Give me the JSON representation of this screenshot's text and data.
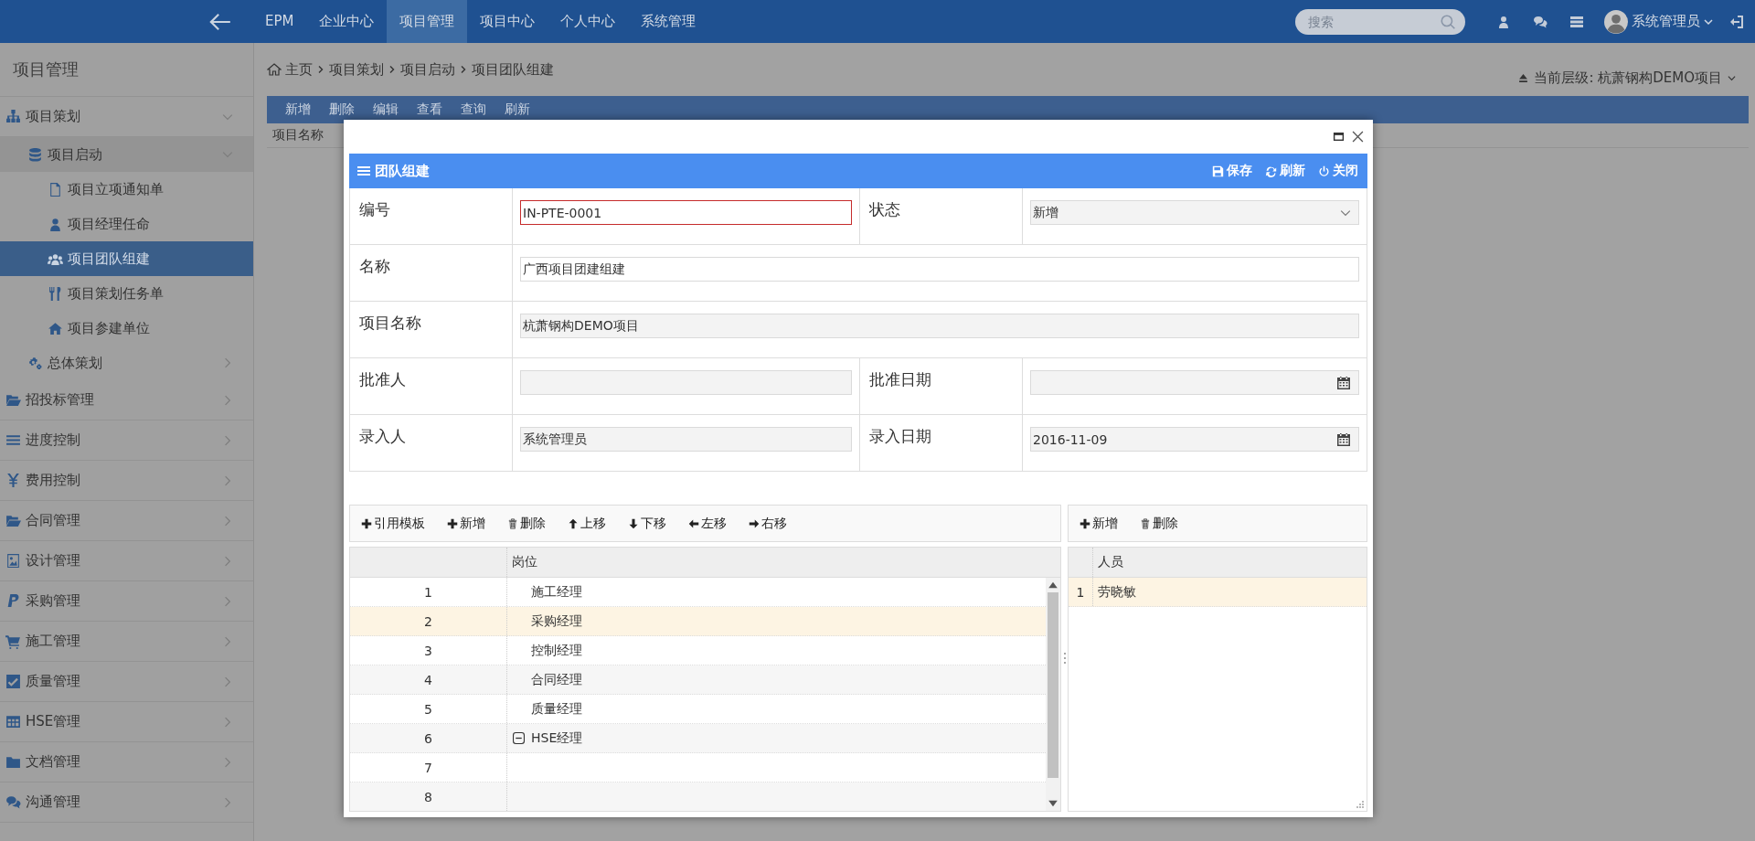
{
  "topbar": {
    "brand": "EPM",
    "nav": [
      {
        "label": "企业中心",
        "selected": false
      },
      {
        "label": "项目管理",
        "selected": true
      },
      {
        "label": "项目中心",
        "selected": false
      },
      {
        "label": "个人中心",
        "selected": false
      },
      {
        "label": "系统管理",
        "selected": false
      }
    ],
    "search": {
      "placeholder": "搜索"
    },
    "user": "系统管理员"
  },
  "sidebar": {
    "title": "项目管理",
    "items": [
      {
        "label": "项目策划",
        "kind": "sitemap",
        "expanded": true,
        "selected": false,
        "children": [
          {
            "label": "项目启动",
            "kind": "database",
            "expanded": true,
            "selected": false,
            "children": [
              {
                "label": "项目立项通知单",
                "kind": "file",
                "selected": false
              },
              {
                "label": "项目经理任命",
                "kind": "user",
                "selected": false
              },
              {
                "label": "项目团队组建",
                "kind": "users",
                "selected": true
              },
              {
                "label": "项目策划任务单",
                "kind": "tools",
                "selected": false
              },
              {
                "label": "项目参建单位",
                "kind": "home",
                "selected": false
              }
            ]
          },
          {
            "label": "总体策划",
            "kind": "gears",
            "expanded": false,
            "selected": false
          }
        ]
      },
      {
        "label": "招投标管理",
        "kind": "folder-open",
        "expanded": false,
        "selected": false
      },
      {
        "label": "进度控制",
        "kind": "bars",
        "expanded": false,
        "selected": false
      },
      {
        "label": "费用控制",
        "kind": "yen",
        "expanded": false,
        "selected": false
      },
      {
        "label": "合同管理",
        "kind": "folder-open",
        "expanded": false,
        "selected": false
      },
      {
        "label": "设计管理",
        "kind": "image",
        "expanded": false,
        "selected": false
      },
      {
        "label": "采购管理",
        "kind": "paypal",
        "expanded": false,
        "selected": false
      },
      {
        "label": "施工管理",
        "kind": "cart",
        "expanded": false,
        "selected": false
      },
      {
        "label": "质量管理",
        "kind": "check",
        "expanded": false,
        "selected": false
      },
      {
        "label": "HSE管理",
        "kind": "table",
        "expanded": false,
        "selected": false
      },
      {
        "label": "文档管理",
        "kind": "folder",
        "expanded": false,
        "selected": false
      },
      {
        "label": "沟通管理",
        "kind": "comments",
        "expanded": false,
        "selected": false
      }
    ]
  },
  "breadcrumb": [
    "主页",
    "项目策划",
    "项目启动",
    "项目团队组建"
  ],
  "level_selector": "当前层级: 杭萧钢构DEMO项目",
  "list_toolbar": [
    "新增",
    "删除",
    "编辑",
    "查看",
    "查询",
    "刷新"
  ],
  "list_columns": [
    "项目名称"
  ],
  "dialog": {
    "title": "团队组建",
    "actions": [
      {
        "label": "保存",
        "kind": "save"
      },
      {
        "label": "刷新",
        "kind": "refresh"
      },
      {
        "label": "关闭",
        "kind": "close"
      }
    ],
    "form_rows": [
      [
        {
          "label": "编号",
          "value": "IN-PTE-0001",
          "kind": "text",
          "readonly": false,
          "invalid": true
        },
        {
          "label": "状态",
          "value": "新增",
          "kind": "select",
          "readonly": true,
          "invalid": false
        }
      ],
      [
        {
          "label": "名称",
          "value": "广西项目团建组建",
          "kind": "text",
          "readonly": false,
          "invalid": false
        }
      ],
      [
        {
          "label": "项目名称",
          "value": "杭萧钢构DEMO项目",
          "kind": "text",
          "readonly": true,
          "invalid": false
        }
      ],
      [
        {
          "label": "批准人",
          "kind": "text",
          "readonly": true,
          "invalid": false
        },
        {
          "label": "批准日期",
          "kind": "date",
          "readonly": true,
          "invalid": false
        }
      ],
      [
        {
          "label": "录入人",
          "value": "系统管理员",
          "kind": "text",
          "readonly": true,
          "invalid": false
        },
        {
          "label": "录入日期",
          "value": "2016-11-09",
          "kind": "date",
          "readonly": true,
          "invalid": false
        }
      ]
    ],
    "positions_toolbar": [
      {
        "label": "引用模板",
        "kind": "add"
      },
      {
        "label": "新增",
        "kind": "add"
      },
      {
        "label": "删除",
        "kind": "delete"
      },
      {
        "label": "上移",
        "kind": "up"
      },
      {
        "label": "下移",
        "kind": "down"
      },
      {
        "label": "左移",
        "kind": "left"
      },
      {
        "label": "右移",
        "kind": "right"
      }
    ],
    "positions_table": {
      "columns": [
        "岗位"
      ],
      "rows": [
        {
          "number": "1",
          "name": "施工经理",
          "selected": false
        },
        {
          "number": "2",
          "name": "采购经理",
          "selected": true
        },
        {
          "number": "3",
          "name": "控制经理",
          "selected": false
        },
        {
          "number": "4",
          "name": "合同经理",
          "selected": false
        },
        {
          "number": "5",
          "name": "质量经理",
          "selected": false
        },
        {
          "number": "6",
          "name": "HSE经理",
          "selected": false,
          "expanded": true
        },
        {
          "number": "7",
          "selected": false
        },
        {
          "number": "8",
          "selected": false
        }
      ]
    },
    "people_toolbar": [
      {
        "label": "新增",
        "kind": "add"
      },
      {
        "label": "删除",
        "kind": "delete"
      }
    ],
    "people_table": {
      "columns": [
        "人员"
      ],
      "rows": [
        {
          "number": "1",
          "name": "劳晓敏",
          "selected": true
        }
      ]
    }
  }
}
